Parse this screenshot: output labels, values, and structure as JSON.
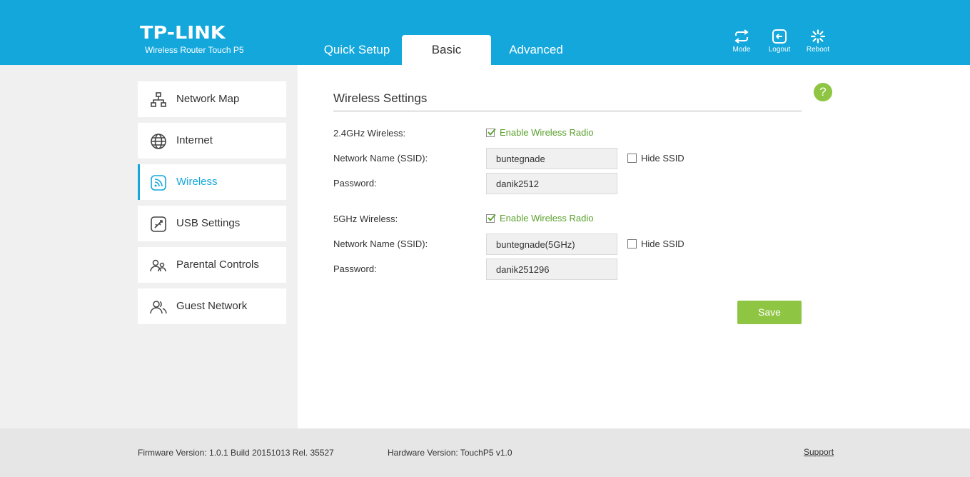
{
  "header": {
    "logo": "TP-LINK",
    "model": "Wireless Router Touch P5",
    "tabs": [
      {
        "label": "Quick Setup",
        "active": false
      },
      {
        "label": "Basic",
        "active": true
      },
      {
        "label": "Advanced",
        "active": false
      }
    ],
    "buttons": {
      "mode": {
        "label": "Mode",
        "icon": "mode-arrows-icon"
      },
      "logout": {
        "label": "Logout",
        "icon": "logout-icon"
      },
      "reboot": {
        "label": "Reboot",
        "icon": "reboot-icon"
      }
    }
  },
  "sidebar": {
    "items": [
      {
        "label": "Network Map",
        "icon": "network-map-icon",
        "active": false
      },
      {
        "label": "Internet",
        "icon": "globe-icon",
        "active": false
      },
      {
        "label": "Wireless",
        "icon": "wireless-icon",
        "active": true
      },
      {
        "label": "USB Settings",
        "icon": "usb-icon",
        "active": false
      },
      {
        "label": "Parental Controls",
        "icon": "parental-controls-icon",
        "active": false
      },
      {
        "label": "Guest Network",
        "icon": "guest-network-icon",
        "active": false
      }
    ]
  },
  "main": {
    "title": "Wireless Settings",
    "help": "?",
    "band24": {
      "label": "2.4GHz Wireless:",
      "enable_label": "Enable Wireless Radio",
      "enabled": true,
      "ssid_label": "Network Name (SSID):",
      "ssid": "buntegnade",
      "hide_label": "Hide SSID",
      "hide_checked": false,
      "password_label": "Password:",
      "password": "danik2512"
    },
    "band5": {
      "label": "5GHz Wireless:",
      "enable_label": "Enable Wireless Radio",
      "enabled": true,
      "ssid_label": "Network Name (SSID):",
      "ssid": "buntegnade(5GHz)",
      "hide_label": "Hide SSID",
      "hide_checked": false,
      "password_label": "Password:",
      "password": "danik251296"
    },
    "save_label": "Save"
  },
  "footer": {
    "firmware": "Firmware Version: 1.0.1 Build 20151013 Rel. 35527",
    "hardware": "Hardware Version: TouchP5 v1.0",
    "support": "Support"
  },
  "colors": {
    "header_bg": "#13a7dc",
    "accent_green": "#8ec543",
    "check_green": "#5aa02c",
    "sidebar_bg": "#f0f0f0",
    "footer_bg": "#e6e6e6"
  }
}
